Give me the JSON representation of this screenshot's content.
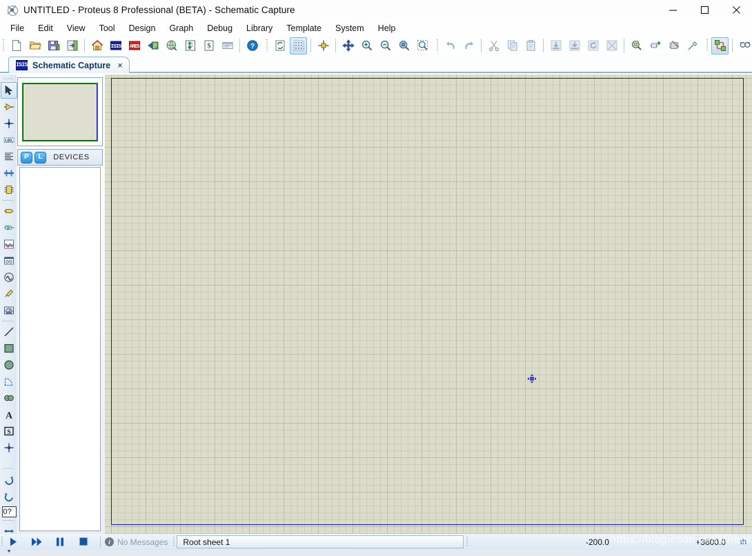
{
  "window": {
    "title": "UNTITLED - Proteus 8 Professional (BETA) - Schematic Capture",
    "app_icon": "proteus-logo-icon",
    "controls": {
      "minimize": "minimize-icon",
      "maximize": "maximize-icon",
      "close": "close-icon"
    }
  },
  "menu": {
    "items": [
      {
        "label": "File"
      },
      {
        "label": "Edit"
      },
      {
        "label": "View"
      },
      {
        "label": "Tool"
      },
      {
        "label": "Design"
      },
      {
        "label": "Graph"
      },
      {
        "label": "Debug"
      },
      {
        "label": "Library"
      },
      {
        "label": "Template"
      },
      {
        "label": "System"
      },
      {
        "label": "Help"
      }
    ]
  },
  "toolbar": {
    "groups": [
      {
        "name": "file-group",
        "buttons": [
          {
            "icon": "new-file-icon",
            "title": "New Project"
          },
          {
            "icon": "open-folder-icon",
            "title": "Open Project"
          },
          {
            "icon": "save-floppy-icon",
            "title": "Save Project"
          },
          {
            "icon": "import-export-icon",
            "title": "Import/Export"
          },
          {
            "icon": "home-icon",
            "title": "Home Page"
          },
          {
            "icon": "isis-icon",
            "title": "Schematic Capture"
          },
          {
            "icon": "ares-icon",
            "title": "PCB Layout"
          },
          {
            "icon": "3d-viewer-icon",
            "title": "3D Visualizer"
          },
          {
            "icon": "design-explorer-globe-icon",
            "title": "Design Explorer"
          },
          {
            "icon": "bill-of-materials-icon",
            "title": "Bill of Materials"
          },
          {
            "icon": "project-notes-icon",
            "title": "Project Notes"
          },
          {
            "icon": "source-code-icon",
            "title": "Source Code"
          },
          {
            "icon": "help-icon",
            "title": "Help"
          }
        ]
      },
      {
        "name": "view-group",
        "buttons": [
          {
            "icon": "redraw-icon",
            "title": "Redraw Display"
          },
          {
            "icon": "toggle-grid-icon",
            "title": "Toggle Grid",
            "active": true
          },
          {
            "icon": "origin-icon",
            "title": "Toggle False Origin"
          },
          {
            "icon": "pan-icon",
            "title": "Centre At Cursor"
          },
          {
            "icon": "zoom-in-icon",
            "title": "Zoom In"
          },
          {
            "icon": "zoom-out-icon",
            "title": "Zoom Out"
          },
          {
            "icon": "zoom-all-icon",
            "title": "Zoom To View Entire Sheet"
          },
          {
            "icon": "zoom-area-icon",
            "title": "Zoom To Area"
          }
        ]
      },
      {
        "name": "edit-group",
        "buttons": [
          {
            "icon": "undo-icon",
            "title": "Undo"
          },
          {
            "icon": "redo-icon",
            "title": "Redo"
          },
          {
            "icon": "cut-icon",
            "title": "Cut To Clipboard"
          },
          {
            "icon": "copy-icon",
            "title": "Copy To Clipboard"
          },
          {
            "icon": "paste-icon",
            "title": "Paste From Clipboard"
          },
          {
            "icon": "block-copy-icon",
            "title": "Block Copy",
            "disabled": true
          },
          {
            "icon": "block-move-icon",
            "title": "Block Move",
            "disabled": true
          },
          {
            "icon": "block-rotate-icon",
            "title": "Block Rotate",
            "disabled": true
          },
          {
            "icon": "block-delete-icon",
            "title": "Block Delete",
            "disabled": true
          }
        ]
      },
      {
        "name": "library-group",
        "buttons": [
          {
            "icon": "pick-device-icon",
            "title": "Pick Parts From Libraries"
          },
          {
            "icon": "make-device-icon",
            "title": "Make Device"
          },
          {
            "icon": "packaging-tool-icon",
            "title": "Packaging Tool"
          },
          {
            "icon": "decompose-icon",
            "title": "Decompose"
          }
        ]
      },
      {
        "name": "tools-group",
        "buttons": [
          {
            "icon": "wire-autorouter-icon",
            "title": "Wire Auto-Router",
            "active": true
          },
          {
            "icon": "search-tag-icon",
            "title": "Search And Tag"
          },
          {
            "icon": "property-assignment-icon",
            "title": "Property Assignment Tool"
          },
          {
            "icon": "new-sheet-icon",
            "title": "New Sheet"
          },
          {
            "icon": "remove-sheet-icon",
            "title": "Remove Sheet"
          },
          {
            "icon": "goto-sheet-icon",
            "title": "Goto Sheet"
          },
          {
            "icon": "design-explorer-icon",
            "title": "Design Explorer"
          }
        ]
      }
    ]
  },
  "document_tab": {
    "icon": "isis-icon",
    "label": "Schematic Capture",
    "close_label": "×"
  },
  "mode_toolbar": {
    "groups": [
      {
        "name": "main-modes",
        "buttons": [
          {
            "icon": "selection-arrow-icon",
            "title": "Selection Mode",
            "active": true
          },
          {
            "icon": "component-mode-icon",
            "title": "Component Mode"
          },
          {
            "icon": "junction-dot-icon",
            "title": "Junction Dot Mode"
          },
          {
            "icon": "wire-label-icon",
            "title": "Wire Label Mode"
          },
          {
            "icon": "text-script-icon",
            "title": "Text Script Mode"
          },
          {
            "icon": "buses-icon",
            "title": "Buses Mode"
          },
          {
            "icon": "subcircuit-icon",
            "title": "Subcircuit Mode"
          }
        ]
      },
      {
        "name": "gadget-modes",
        "buttons": [
          {
            "icon": "terminals-icon",
            "title": "Terminals Mode"
          },
          {
            "icon": "device-pin-icon",
            "title": "Device Pins Mode"
          },
          {
            "icon": "graph-icon",
            "title": "Graph Mode"
          },
          {
            "icon": "tape-recorder-icon",
            "title": "Tape Recorder Mode"
          },
          {
            "icon": "generator-icon",
            "title": "Generator Mode"
          },
          {
            "icon": "voltage-probe-icon",
            "title": "Voltage Probe Mode"
          },
          {
            "icon": "virtual-instrument-icon",
            "title": "Virtual Instruments Mode"
          }
        ]
      },
      {
        "name": "draw-modes",
        "buttons": [
          {
            "icon": "line-tool-icon",
            "title": "2D Graphics Line Mode"
          },
          {
            "icon": "box-tool-icon",
            "title": "2D Graphics Box Mode"
          },
          {
            "icon": "circle-tool-icon",
            "title": "2D Graphics Circle Mode"
          },
          {
            "icon": "arc-tool-icon",
            "title": "2D Graphics Arc Mode"
          },
          {
            "icon": "path-tool-icon",
            "title": "2D Graphics Path Mode"
          },
          {
            "icon": "text-tool-icon",
            "title": "2D Graphics Text Mode"
          },
          {
            "icon": "symbol-tool-icon",
            "title": "2D Graphics Symbols Mode"
          },
          {
            "icon": "marker-tool-icon",
            "title": "2D Graphics Markers Mode"
          }
        ]
      },
      {
        "name": "orientation",
        "rotation_value": "0?",
        "buttons": [
          {
            "icon": "rotate-clockwise-icon",
            "title": "Rotate Clockwise"
          },
          {
            "icon": "rotate-anticlockwise-icon",
            "title": "Rotate Anti-Clockwise"
          },
          {
            "icon": "mirror-horizontal-icon",
            "title": "Mirror Horizontally"
          },
          {
            "icon": "mirror-vertical-icon",
            "title": "Mirror Vertically"
          }
        ]
      }
    ]
  },
  "preview_panel": {
    "name": "overview-preview",
    "sheet_fill": "#dfdfd0",
    "border_color": "#1a1aaa",
    "outline_color": "#18a018"
  },
  "devices_panel": {
    "buttons": [
      {
        "label": "P",
        "title": "Pick Devices"
      },
      {
        "label": "L",
        "title": "Library Manager"
      }
    ],
    "title": "DEVICES",
    "items": []
  },
  "canvas": {
    "background": "#dcdccb",
    "grid_minor": "#cbcbbb",
    "grid_major": "#bdbdae",
    "sheet_border": "#1414c8",
    "origin_marker": "origin-cursor-icon"
  },
  "status_bar": {
    "transport": [
      {
        "icon": "play-icon",
        "title": "Run Simulation"
      },
      {
        "icon": "step-icon",
        "title": "Step Simulation"
      },
      {
        "icon": "pause-icon",
        "title": "Pause Simulation"
      },
      {
        "icon": "stop-icon",
        "title": "Stop Simulation"
      }
    ],
    "message": "No Messages",
    "message_icon": "info-icon",
    "sheet": "Root sheet 1",
    "coord_x": "-200.0",
    "coord_y": "+3600.0",
    "coord_units": "th"
  },
  "watermark": {
    "text": "https://blog.csdn.net/Mirecz"
  }
}
